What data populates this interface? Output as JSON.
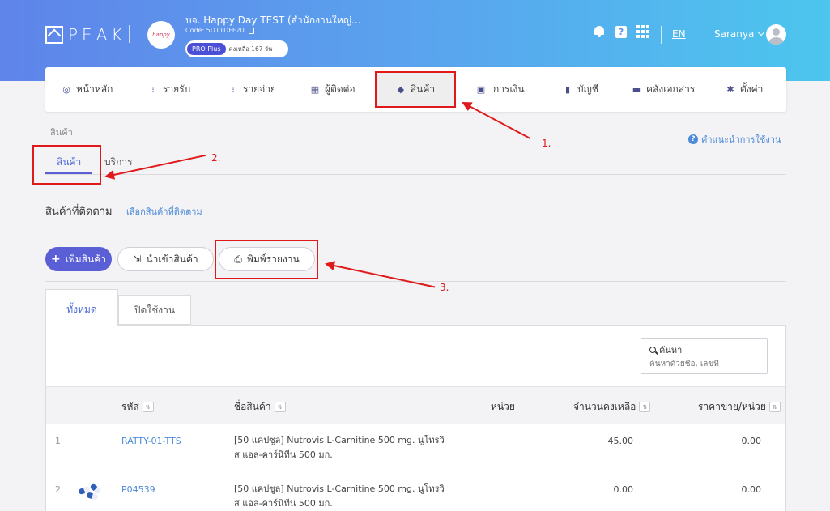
{
  "header": {
    "logo_text": "PEAK",
    "company_name": "บจ. Happy Day TEST (สำนักงานใหญ่...",
    "company_logo_text": "happy",
    "company_code": "Code: 5D11DFF20",
    "plan_badge": "PRO Plus",
    "plan_remaining": "คงเหลือ 167 วัน",
    "help_icon_text": "?",
    "language": "EN",
    "user_name": "Saranya"
  },
  "nav": {
    "items": [
      {
        "label": "หน้าหลัก",
        "icon": "dashboard-icon"
      },
      {
        "label": "รายรับ",
        "icon": "income-icon"
      },
      {
        "label": "รายจ่าย",
        "icon": "expense-icon"
      },
      {
        "label": "ผู้ติดต่อ",
        "icon": "contacts-icon"
      },
      {
        "label": "สินค้า",
        "icon": "box-icon"
      },
      {
        "label": "การเงิน",
        "icon": "money-icon"
      },
      {
        "label": "บัญชี",
        "icon": "ledger-icon"
      },
      {
        "label": "คลังเอกสาร",
        "icon": "folder-icon"
      },
      {
        "label": "ตั้งค่า",
        "icon": "gear-icon"
      }
    ]
  },
  "page": {
    "breadcrumb": "สินค้า",
    "help_link": "คำแนะนำการใช้งาน",
    "tab_products": "สินค้า",
    "tab_services": "บริการ",
    "tracked_title": "สินค้าที่ติดตาม",
    "tracked_link": "เลือกสินค้าที่ติดตาม",
    "add_button": "เพิ่มสินค้า",
    "import_button": "นำเข้าสินค้า",
    "print_button": "พิมพ์รายงาน",
    "filter_all": "ทั้งหมด",
    "filter_disabled": "ปิดใช้งาน",
    "search_label": "ค้นหา",
    "search_placeholder": "ค้นหาด้วยชื่อ, เลขที่"
  },
  "table": {
    "columns": [
      "รหัส",
      "ชื่อสินค้า",
      "หน่วย",
      "จำนวนคงเหลือ",
      "ราคาขาย/หน่วย"
    ],
    "rows": [
      {
        "no": "1",
        "code": "RATTY-01-TTS",
        "name": "[50 แคปซูล] Nutrovis L-Carnitine 500 mg. นูโทรวิส แอล-คาร์นิทีน 500 มก.",
        "unit": "",
        "stock": "45.00",
        "price": "0.00"
      },
      {
        "no": "2",
        "code": "P04539",
        "name": "[50 แคปซูล] Nutrovis L-Carnitine 500 mg. นูโทรวิส แอล-คาร์นิทีน 500 มก.",
        "unit": "",
        "stock": "0.00",
        "price": "0.00"
      }
    ]
  },
  "annotations": [
    "1.",
    "2.",
    "3."
  ],
  "colors": {
    "accent": "#5a5fd6",
    "link": "#4d8ad8",
    "annotation": "#e0191b"
  }
}
